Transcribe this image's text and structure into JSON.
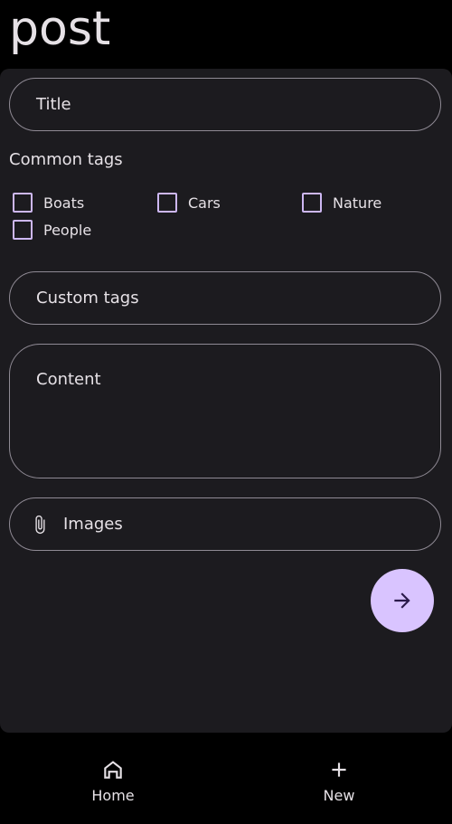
{
  "header": {
    "title": "post"
  },
  "form": {
    "title_placeholder": "Title",
    "common_tags_label": "Common tags",
    "tags": [
      "Boats",
      "Cars",
      "Nature",
      "People"
    ],
    "custom_tags_placeholder": "Custom tags",
    "content_placeholder": "Content",
    "images_label": "Images",
    "submit_icon": "arrow-forward-icon"
  },
  "nav": {
    "items": [
      {
        "label": "Home",
        "icon": "home-icon"
      },
      {
        "label": "New",
        "icon": "plus-icon"
      }
    ]
  },
  "colors": {
    "background": "#000000",
    "card": "#1c1b1f",
    "outline": "#8f8a94",
    "accent": "#cdb7f2",
    "fab": "#d9c4ff",
    "text": "#e6e1e6"
  }
}
